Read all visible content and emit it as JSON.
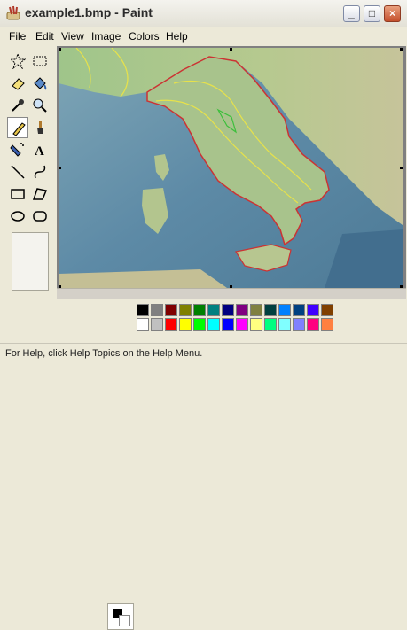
{
  "window": {
    "title": "example1.bmp - Paint"
  },
  "menu": [
    "File",
    "Edit",
    "View",
    "Image",
    "Colors",
    "Help"
  ],
  "tools": [
    "free-form-select",
    "select",
    "eraser",
    "fill-with-color",
    "pick-color",
    "magnifier",
    "pencil",
    "brush",
    "airbrush",
    "text",
    "line",
    "curve",
    "rectangle",
    "polygon",
    "ellipse",
    "rounded-rectangle"
  ],
  "selected_tool": "pencil",
  "current_colors": {
    "foreground": "#000000",
    "background": "#ffffff"
  },
  "palette": {
    "top": [
      "#000000",
      "#808080",
      "#800000",
      "#808000",
      "#008000",
      "#008080",
      "#000080",
      "#800080",
      "#808040",
      "#004040",
      "#0080ff",
      "#004080",
      "#4000ff",
      "#804000"
    ],
    "bottom": [
      "#ffffff",
      "#c0c0c0",
      "#ff0000",
      "#ffff00",
      "#00ff00",
      "#00ffff",
      "#0000ff",
      "#ff00ff",
      "#ffff80",
      "#00ff80",
      "#80ffff",
      "#8080ff",
      "#ff0080",
      "#ff8040"
    ]
  },
  "status": {
    "text": "For Help, click Help Topics on the Help Menu."
  }
}
